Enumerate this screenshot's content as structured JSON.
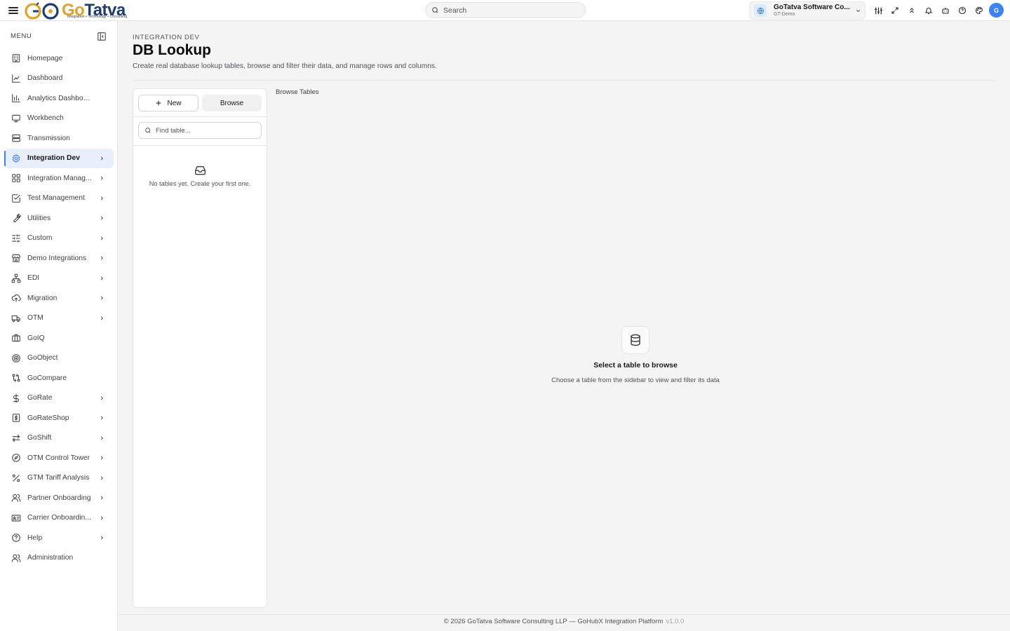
{
  "topbar": {
    "logo_go": "Go",
    "logo_tatva": "Tatva",
    "logo_tagline": "Integration • Technology • Consulting",
    "search_placeholder": "Search",
    "org_name": "GoTatva Software Co...",
    "org_env": "GT-Demo",
    "avatar_initial": "G",
    "icons": [
      "sliders-icon",
      "expand-icon",
      "chevrons-up-icon",
      "bell-icon",
      "bot-icon",
      "help-circle-icon",
      "palette-icon"
    ]
  },
  "sidebar": {
    "menu_label": "MENU",
    "items": [
      {
        "label": "Homepage",
        "icon": "building-icon",
        "chevron": false
      },
      {
        "label": "Dashboard",
        "icon": "line-chart-icon",
        "chevron": false
      },
      {
        "label": "Analytics Dashboard",
        "icon": "bar-chart-icon",
        "chevron": false
      },
      {
        "label": "Workbench",
        "icon": "monitor-icon",
        "chevron": false
      },
      {
        "label": "Transmission",
        "icon": "server-icon",
        "chevron": false
      },
      {
        "label": "Integration Dev",
        "icon": "gear-icon",
        "chevron": true,
        "active": true
      },
      {
        "label": "Integration Manag...",
        "icon": "grid-icon",
        "chevron": true
      },
      {
        "label": "Test Management",
        "icon": "check-square-icon",
        "chevron": true
      },
      {
        "label": "Utilities",
        "icon": "wrench-icon",
        "chevron": true
      },
      {
        "label": "Custom",
        "icon": "sliders-horizontal-icon",
        "chevron": true
      },
      {
        "label": "Demo Integrations",
        "icon": "store-icon",
        "chevron": true
      },
      {
        "label": "EDI",
        "icon": "network-icon",
        "chevron": true
      },
      {
        "label": "Migration",
        "icon": "cloud-upload-icon",
        "chevron": true
      },
      {
        "label": "OTM",
        "icon": "truck-icon",
        "chevron": true
      },
      {
        "label": "GoIQ",
        "icon": "luggage-icon",
        "chevron": false
      },
      {
        "label": "GoObject",
        "icon": "target-icon",
        "chevron": false
      },
      {
        "label": "GoCompare",
        "icon": "git-compare-icon",
        "chevron": false
      },
      {
        "label": "GoRate",
        "icon": "dollar-icon",
        "chevron": true
      },
      {
        "label": "GoRateShop",
        "icon": "receipt-dollar-icon",
        "chevron": true
      },
      {
        "label": "GoShift",
        "icon": "arrows-exchange-icon",
        "chevron": true
      },
      {
        "label": "OTM Control Tower",
        "icon": "compass-icon",
        "chevron": true
      },
      {
        "label": "GTM Tariff Analysis",
        "icon": "percent-icon",
        "chevron": true
      },
      {
        "label": "Partner Onboarding",
        "icon": "users-icon",
        "chevron": true
      },
      {
        "label": "Carrier Onboardin...",
        "icon": "id-card-icon",
        "chevron": true
      },
      {
        "label": "Help",
        "icon": "help-circle-icon",
        "chevron": true
      },
      {
        "label": "Administration",
        "icon": "users-icon",
        "chevron": false
      }
    ]
  },
  "main": {
    "breadcrumb": "INTEGRATION DEV",
    "title": "DB Lookup",
    "description": "Create real database lookup tables, browse and filter their data, and manage rows and columns.",
    "panel": {
      "new_label": "New",
      "browse_label": "Browse",
      "find_placeholder": "Find table...",
      "empty_text": "No tables yet. Create your first one."
    },
    "browse_header": "Browse Tables",
    "empty_state": {
      "title": "Select a table to browse",
      "subtitle": "Choose a table from the sidebar to view and filter its data"
    }
  },
  "footer": {
    "text": "© 2026 GoTatva Software Consulting LLP — GoHubX Integration Platform",
    "version": "v1.0.0"
  },
  "colors": {
    "accent": "#3b82f6",
    "active_bg": "#e8effb",
    "logo_orange": "#e0a32a",
    "logo_navy": "#1f3b73"
  }
}
